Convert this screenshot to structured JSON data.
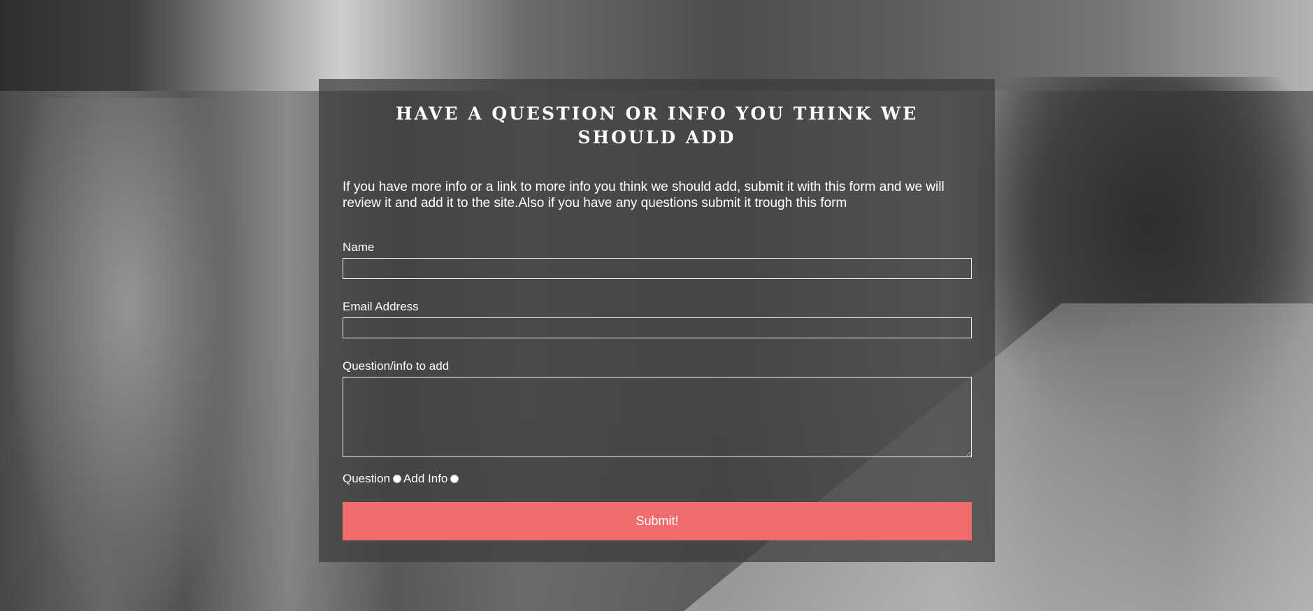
{
  "form": {
    "title": "HAVE A QUESTION OR INFO YOU THINK WE SHOULD ADD",
    "intro": "If you have more info or a link to more info you think we should add, submit it with this form and we will review it and add it to the site.Also if you have any questions submit it trough this form",
    "fields": {
      "name_label": "Name",
      "name_value": "",
      "email_label": "Email Address",
      "email_value": "",
      "message_label": "Question/info to add",
      "message_value": ""
    },
    "radio": {
      "question_label": "Question",
      "add_info_label": "Add Info"
    },
    "submit_label": "Submit!"
  },
  "colors": {
    "panel_background": "#3c3c3c",
    "submit_button": "#f06b6b",
    "text": "#ffffff"
  }
}
